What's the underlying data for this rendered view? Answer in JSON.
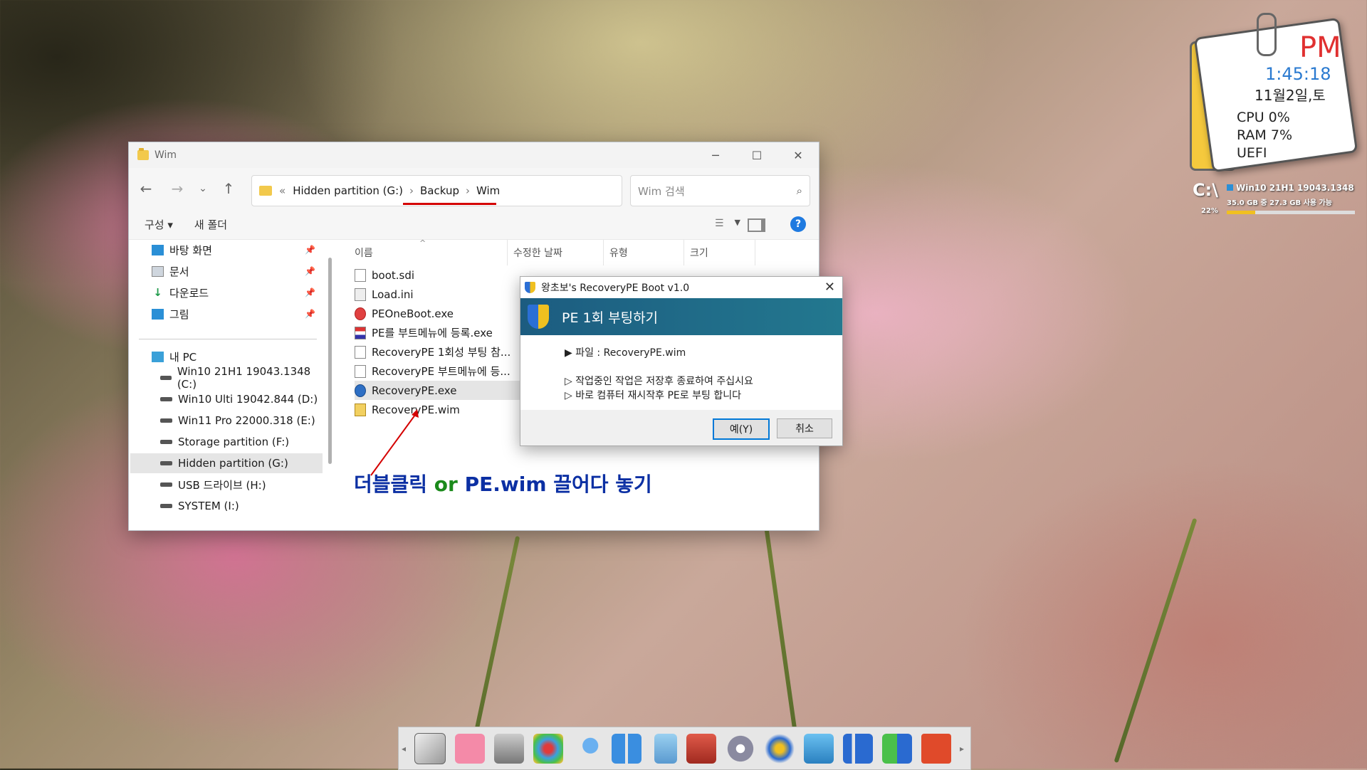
{
  "explorer": {
    "title": "Wim",
    "breadcrumb": [
      "Hidden partition (G:)",
      "Backup",
      "Wim"
    ],
    "breadcrumb_prefix": "«",
    "search_placeholder": "Wim 검색",
    "commands": {
      "organize": "구성 ▾",
      "new_folder": "새 폴더"
    },
    "nav_quick": [
      {
        "label": "바탕 화면",
        "icon": "desktop-icon"
      },
      {
        "label": "문서",
        "icon": "documents-icon"
      },
      {
        "label": "다운로드",
        "icon": "download-icon"
      },
      {
        "label": "그림",
        "icon": "pictures-icon"
      }
    ],
    "nav_pc": "내 PC",
    "drives": [
      "Win10 21H1 19043.1348 (C:)",
      "Win10 Ulti 19042.844 (D:)",
      "Win11 Pro 22000.318 (E:)",
      "Storage partition (F:)",
      "Hidden partition (G:)",
      "USB 드라이브 (H:)",
      "SYSTEM (I:)"
    ],
    "columns": [
      "이름",
      "수정한 날짜",
      "유형",
      "크기"
    ],
    "files": [
      "boot.sdi",
      "Load.ini",
      "PEOneBoot.exe",
      "PE를 부트메뉴에 등록.exe",
      "RecoveryPE 1회성 부팅 참...",
      "RecoveryPE 부트메뉴에 등...",
      "RecoveryPE.exe",
      "RecoveryPE.wim"
    ],
    "annotation": {
      "part1": "더블클릭",
      "part2": "or",
      "part3": "PE.wim 끌어다 놓기"
    }
  },
  "dialog": {
    "title": "왕초보's RecoveryPE Boot v1.0",
    "heading": "PE 1회 부팅하기",
    "line1": "▶ 파일 : RecoveryPE.wim",
    "line2": "▷ 작업중인 작업은 저장후 종료하여 주십시요",
    "line3": "▷ 바로 컴퓨터 재시작후 PE로 부팅 합니다",
    "yes": "예(Y)",
    "cancel": "취소"
  },
  "clock_widget": {
    "ampm": "PM",
    "time": "1:45:18",
    "date": "11월2일,토",
    "cpu": "CPU  0%",
    "ram": "RAM  7%",
    "boot": "UEFI"
  },
  "disk_widget": {
    "drive": "C:\\",
    "name": "Win10 21H1 19043.1348",
    "usage": "35.0 GB 중  27.3 GB 사용 가능",
    "percent_label": "22%",
    "percent": 22
  },
  "taskbar_icons": [
    "drive-tool-icon",
    "windows-start-icon",
    "scanner-icon",
    "paint-icon",
    "search-tool-icon",
    "grid-apps-icon",
    "phone-icon",
    "toolbox-icon",
    "disk-tool-icon",
    "windows-logo-icon",
    "camera-icon",
    "chart-app-icon",
    "install-icon",
    "power-icon"
  ],
  "colors": {
    "accent": "#0078d7",
    "annotation_blue": "#0b2fa3",
    "annotation_green": "#1b8a1b",
    "underline_red": "#d40000"
  }
}
